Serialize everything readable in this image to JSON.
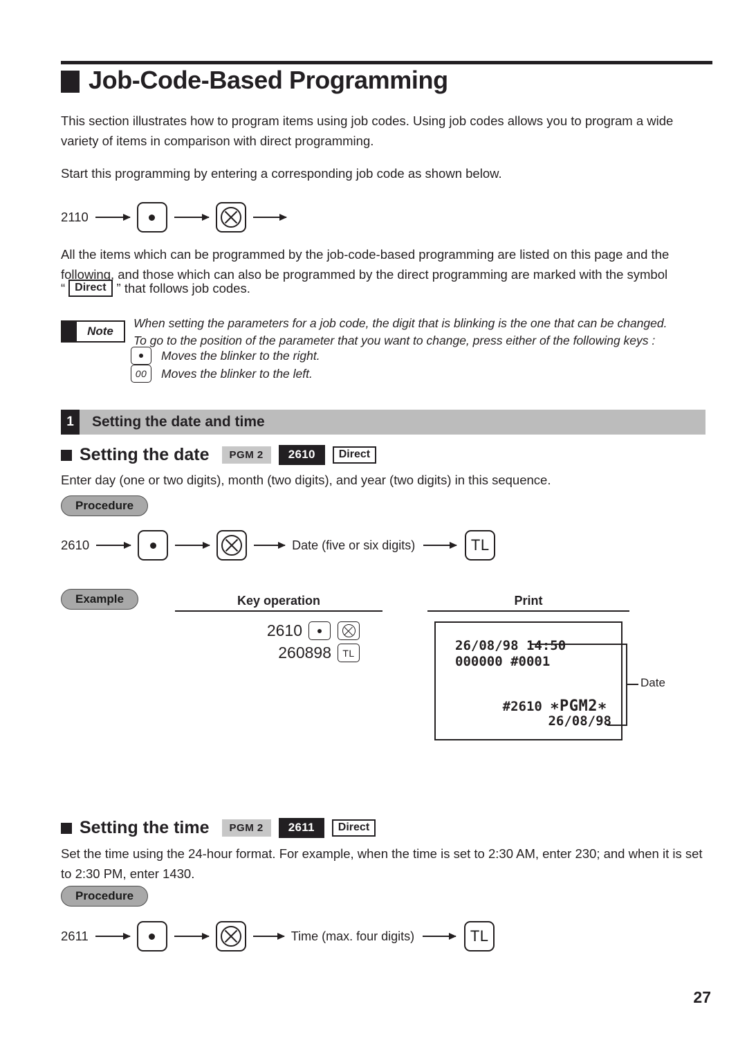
{
  "document": {
    "title": "Job-Code-Based Programming",
    "page_number": "27"
  },
  "intro": {
    "paragraph_1": "This section illustrates how to program items using job codes. Using job codes allows you to program a wide variety of items in comparison with direct programming.",
    "paragraph_2": "Start this programming by entering a corresponding job code as shown below.",
    "paragraph_3": "All the items which can be programmed by the job-code-based programming are listed on this page and the following, and those which can also be programmed by the direct programming are marked with the symbol",
    "direct_prefix": "“",
    "direct_badge": "Direct",
    "direct_suffix": "” that follows job codes."
  },
  "top_flow": {
    "code": "2110",
    "key_1": "point-key",
    "key_2": "multiply-key"
  },
  "note": {
    "label": "Note",
    "line_1": "When setting the parameters for a job code, the digit that is blinking is the one that can be changed.",
    "line_2": "To go to the position of the parameter that you want to change, press either of the following keys :",
    "key_right_label": "Moves the blinker to the right.",
    "key_left_text": "00",
    "key_left_label": "Moves the blinker to the left."
  },
  "section": {
    "number": "1",
    "title": "Setting the date and time"
  },
  "date_block": {
    "heading": "Setting the date",
    "badge_pgm": "PGM 2",
    "badge_code": "2610",
    "badge_direct": "Direct",
    "description": "Enter day (one or two digits), month (two digits), and year (two digits) in this sequence.",
    "procedure_label": "Procedure",
    "procedure_flow": {
      "code": "2610",
      "key_1": "point-key",
      "key_2": "multiply-key",
      "entry_label": "Date (five or six digits)",
      "final_key": "TL"
    },
    "example_label": "Example",
    "col_key_operation": "Key operation",
    "col_print": "Print",
    "key_operation_lines": [
      {
        "number": "2610",
        "keys": [
          "point-key",
          "multiply-key"
        ]
      },
      {
        "number": "260898",
        "keys": [
          "TL"
        ]
      }
    ],
    "receipt": {
      "line_1": "26/08/98 14:50",
      "line_2": "000000 #0001",
      "line_3_code": "#2610",
      "line_3_mode": "∗PGM2∗",
      "line_4": "26/08/98",
      "callout_label": "Date"
    }
  },
  "time_block": {
    "heading": "Setting the time",
    "badge_pgm": "PGM 2",
    "badge_code": "2611",
    "badge_direct": "Direct",
    "description": "Set the time using the 24-hour format.  For example, when the time is set to 2:30 AM, enter 230; and when it is set to 2:30 PM, enter 1430.",
    "procedure_label": "Procedure",
    "procedure_flow": {
      "code": "2611",
      "key_1": "point-key",
      "key_2": "multiply-key",
      "entry_label": "Time (max. four digits)",
      "final_key": "TL"
    }
  },
  "colors": {
    "ink": "#231f20",
    "section_bar": "#bcbcbc",
    "badge_gray": "#c7c7c7",
    "pill_gray": "#a8a8a8"
  }
}
